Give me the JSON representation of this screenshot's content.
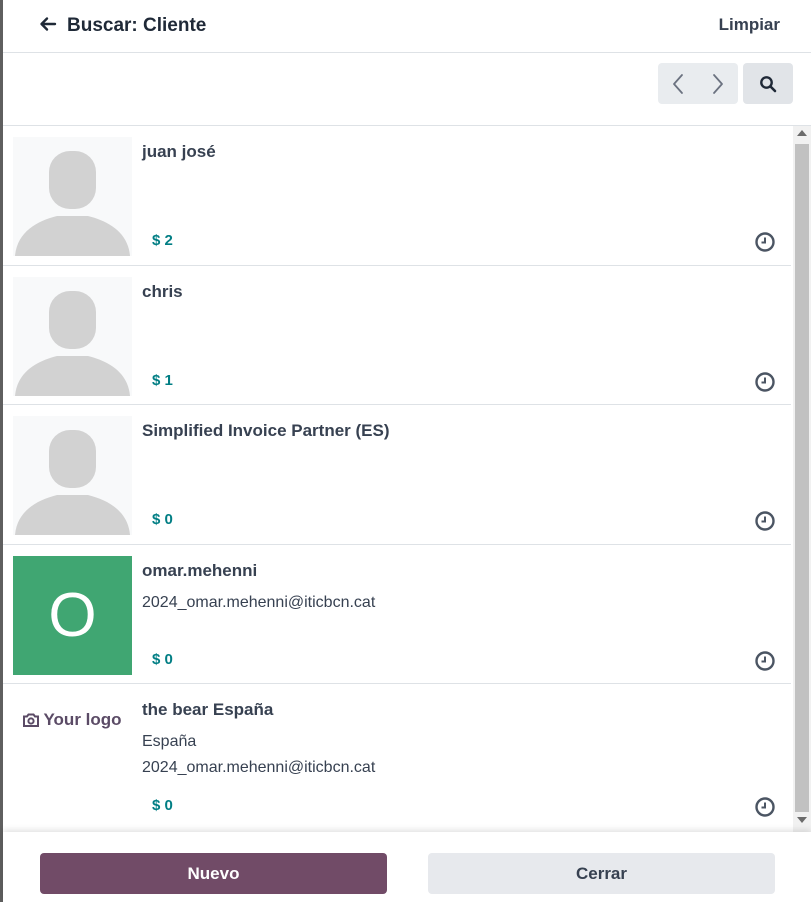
{
  "header": {
    "title": "Buscar: Cliente",
    "clear_label": "Limpiar"
  },
  "toolbar": {
    "icons": [
      "chevron-left-icon",
      "chevron-right-icon",
      "search-icon"
    ]
  },
  "customers": [
    {
      "name": "juan josé",
      "lines": [],
      "balance": "$ 2",
      "avatar": "placeholder"
    },
    {
      "name": "chris",
      "lines": [],
      "balance": "$ 1",
      "avatar": "placeholder"
    },
    {
      "name": "Simplified Invoice Partner (ES)",
      "lines": [],
      "balance": "$ 0",
      "avatar": "placeholder"
    },
    {
      "name": "omar.mehenni",
      "lines": [
        "2024_omar.mehenni@iticbcn.cat"
      ],
      "balance": "$ 0",
      "avatar": "letter",
      "avatar_letter": "O",
      "avatar_color": "#40a672"
    },
    {
      "name": "the bear España",
      "lines": [
        "España",
        "2024_omar.mehenni@iticbcn.cat"
      ],
      "balance": "$ 0",
      "avatar": "logo",
      "logo_text": "Your logo"
    }
  ],
  "footer": {
    "new_label": "Nuevo",
    "close_label": "Cerrar"
  },
  "colors": {
    "primary": "#714b67",
    "balance": "#017e84",
    "avatar_green": "#40a672"
  }
}
